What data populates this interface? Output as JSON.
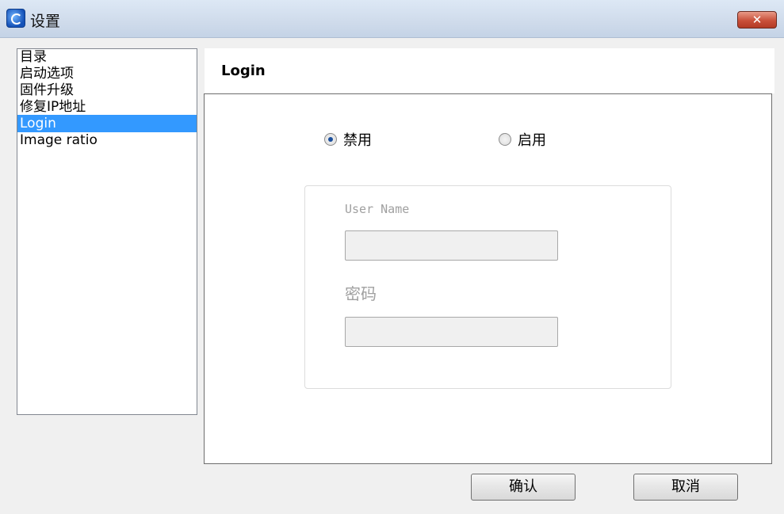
{
  "window": {
    "title": "设置",
    "close_label": "✕"
  },
  "nav": {
    "items": [
      {
        "label": "目录"
      },
      {
        "label": "启动选项"
      },
      {
        "label": "固件升级"
      },
      {
        "label": "修复IP地址"
      },
      {
        "label": "Login",
        "selected": true
      },
      {
        "label": "Image ratio"
      }
    ]
  },
  "content": {
    "title": "Login",
    "radio_disable": {
      "label": "禁用",
      "checked": true
    },
    "radio_enable": {
      "label": "启用",
      "checked": false
    },
    "username": {
      "label": "User Name",
      "value": ""
    },
    "password": {
      "label": "密码",
      "value": ""
    }
  },
  "buttons": {
    "confirm": "确认",
    "cancel": "取消"
  }
}
